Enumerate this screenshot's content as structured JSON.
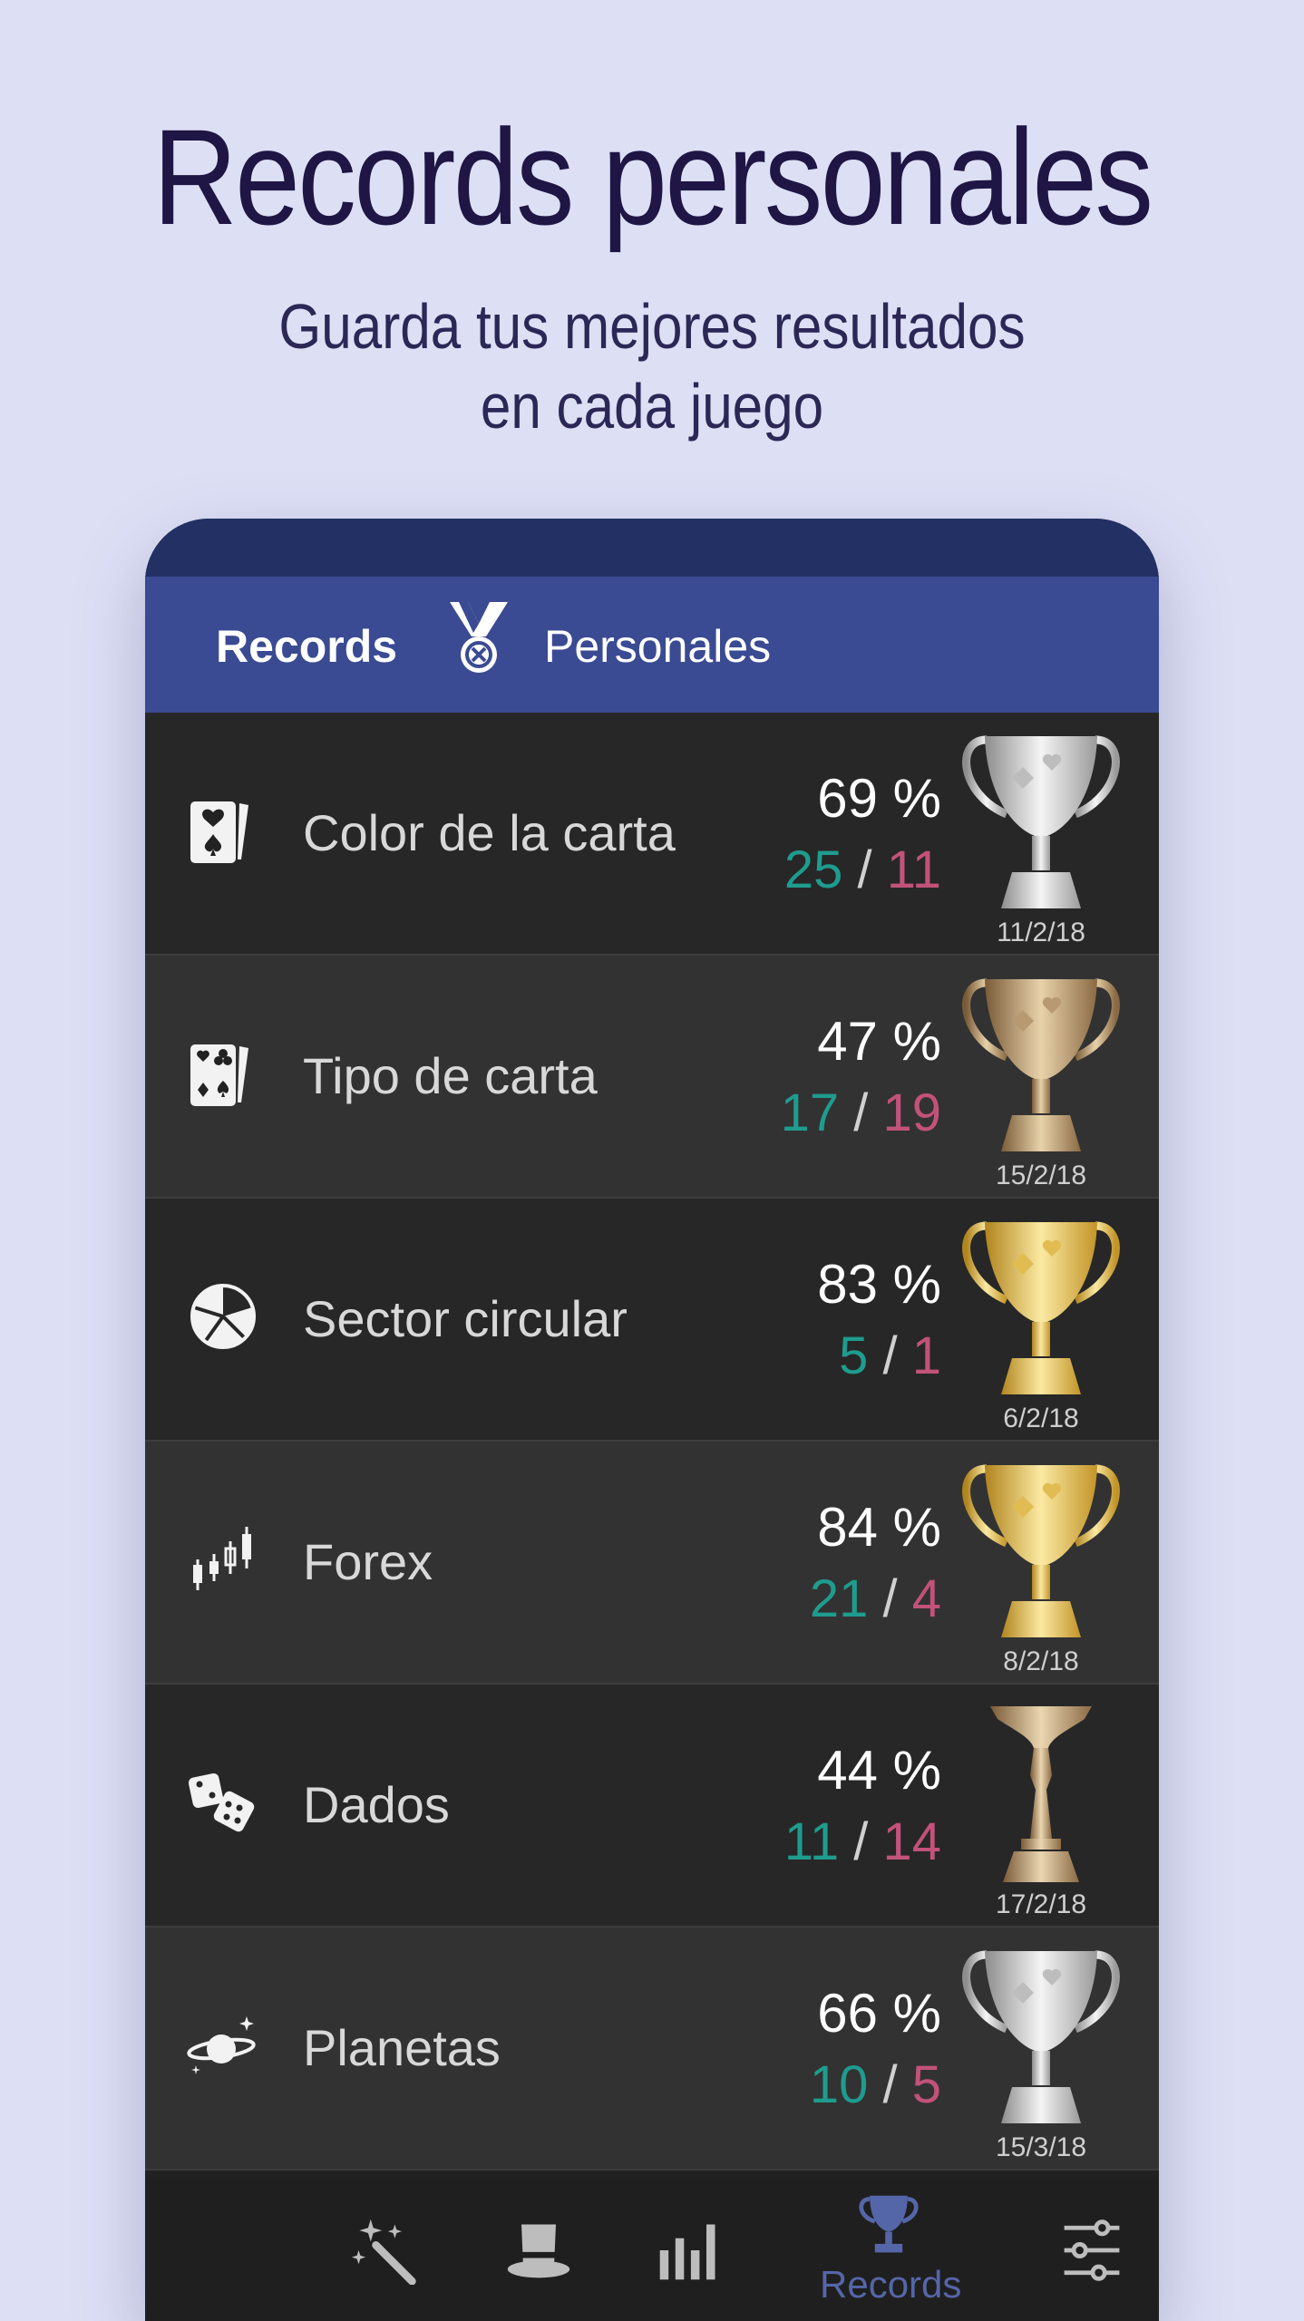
{
  "promo": {
    "title": "Records personales",
    "subtitle_line1": "Guarda tus mejores resultados",
    "subtitle_line2": "en cada juego"
  },
  "appbar": {
    "title": "Records",
    "subtitle": "Personales",
    "icon": "medal-icon"
  },
  "records": [
    {
      "name": "Color de la carta",
      "percent": "69 %",
      "wins": "25",
      "losses": "11",
      "date": "11/2/18",
      "trophy": "silver",
      "icon": "card-suits-icon"
    },
    {
      "name": "Tipo de carta",
      "percent": "47 %",
      "wins": "17",
      "losses": "19",
      "date": "15/2/18",
      "trophy": "bronze",
      "icon": "card-type-icon"
    },
    {
      "name": "Sector circular",
      "percent": "83 %",
      "wins": "5",
      "losses": "1",
      "date": "6/2/18",
      "trophy": "gold",
      "icon": "pie-sector-icon"
    },
    {
      "name": "Forex",
      "percent": "84 %",
      "wins": "21",
      "losses": "4",
      "date": "8/2/18",
      "trophy": "gold",
      "icon": "candlestick-icon"
    },
    {
      "name": "Dados",
      "percent": "44 %",
      "wins": "11",
      "losses": "14",
      "date": "17/2/18",
      "trophy": "bronze-cup",
      "icon": "dice-icon"
    },
    {
      "name": "Planetas",
      "percent": "66 %",
      "wins": "10",
      "losses": "5",
      "date": "15/3/18",
      "trophy": "silver",
      "icon": "planet-icon"
    }
  ],
  "score_separator": "/",
  "colors": {
    "win": "#1e9c8e",
    "loss": "#c2527a",
    "gold": "#e3bd45",
    "silver": "#c9c9c9",
    "bronze": "#b98f60",
    "appbar": "#3a4b93",
    "nav_active": "#5566a8"
  },
  "bottom_nav": [
    {
      "icon": "magic-wand-icon",
      "label": ""
    },
    {
      "icon": "top-hat-icon",
      "label": ""
    },
    {
      "icon": "bar-chart-icon",
      "label": ""
    },
    {
      "icon": "trophy-icon",
      "label": "Records",
      "active": true
    },
    {
      "icon": "sliders-icon",
      "label": ""
    }
  ]
}
